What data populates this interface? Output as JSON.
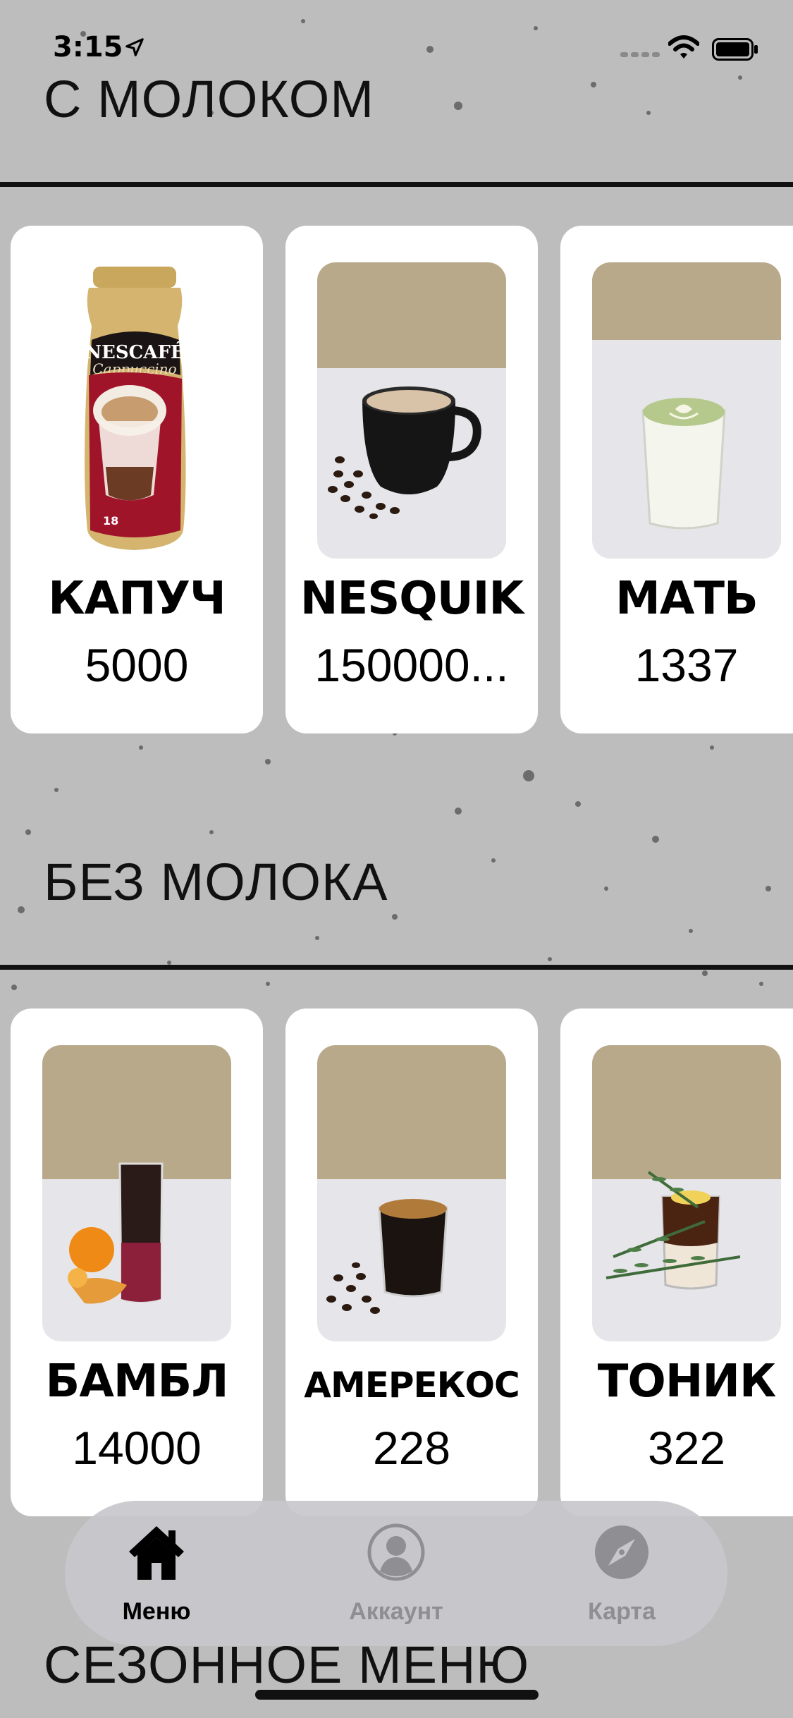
{
  "status_bar": {
    "time": "3:15",
    "icons": [
      "location-arrow-icon",
      "cellular-signal-icon",
      "wifi-icon",
      "battery-icon"
    ]
  },
  "sections": [
    {
      "title": "С МОЛОКОМ",
      "items": [
        {
          "name": "КАПУЧ",
          "price": "5000",
          "image": "nescafe-cappuccino-jar"
        },
        {
          "name": "NESQUIK",
          "price": "150000...",
          "image": "black-cup-with-milk-drink"
        },
        {
          "name": "МАТЬ",
          "price": "1337",
          "image": "matcha-latte-glass"
        }
      ]
    },
    {
      "title": "БЕЗ МОЛОКА",
      "items": [
        {
          "name": "БАМБЛ",
          "price": "14000",
          "image": "bumble-coffee-with-orange"
        },
        {
          "name": "АМЕРЕКОС",
          "price": "228",
          "image": "americano-glass"
        },
        {
          "name": "ТОНИК",
          "price": "322",
          "image": "espresso-tonic-with-rosemary"
        }
      ]
    },
    {
      "title": "СЕЗОННОЕ МЕНЮ",
      "items": []
    }
  ],
  "tab_bar": {
    "tabs": [
      {
        "label": "Меню",
        "icon": "house-icon",
        "active": true
      },
      {
        "label": "Аккаунт",
        "icon": "person-circle-icon",
        "active": false
      },
      {
        "label": "Карта",
        "icon": "compass-icon",
        "active": false
      }
    ]
  },
  "colors": {
    "background": "#bdbdbd",
    "card": "#ffffff",
    "text": "#000000",
    "tab_active": "#000000",
    "tab_inactive": "#8e8e93"
  }
}
